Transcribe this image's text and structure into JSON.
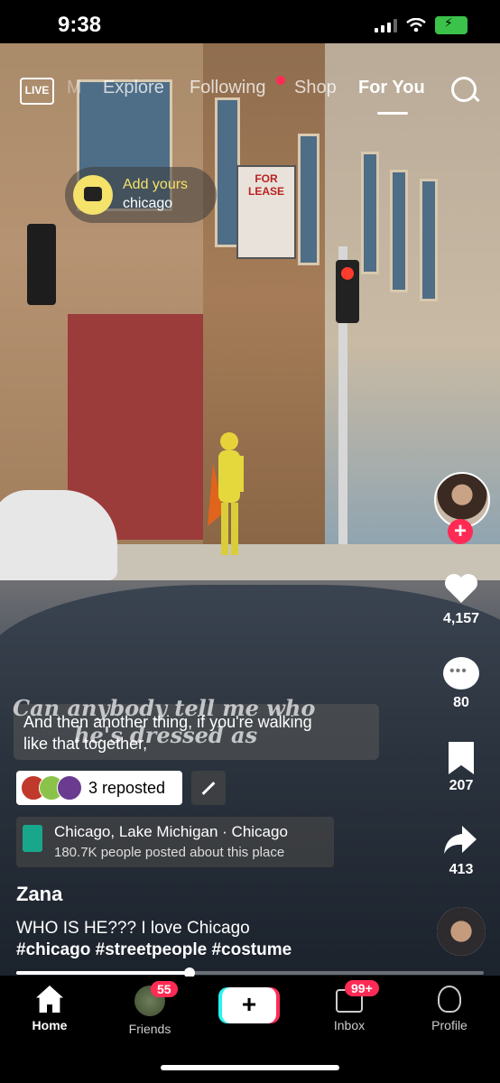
{
  "status_bar": {
    "time": "9:38"
  },
  "top_nav": {
    "live_label": "LIVE",
    "partial_item": "M",
    "items": [
      "Explore",
      "Following",
      "Shop",
      "For You"
    ],
    "active": "For You"
  },
  "add_yours": {
    "label": "Add yours",
    "topic": "chicago"
  },
  "video_overlay_text": {
    "line1": "Can anybody tell me who",
    "line2": "he's dressed as"
  },
  "captions": {
    "line1": "And then another thing, if you're walking",
    "line2": "like that together,"
  },
  "sign_text": "FOR LEASE",
  "rail": {
    "likes": "4,157",
    "comments": "80",
    "saves": "207",
    "shares": "413"
  },
  "repost": {
    "label": "3 reposted"
  },
  "location": {
    "name": "Chicago, Lake Michigan · Chicago",
    "sub": "180.7K people posted about this place"
  },
  "post": {
    "username": "Zana",
    "description": "WHO IS HE??? I love Chicago",
    "hashtags": "#chicago #streetpeople #costume"
  },
  "progress": {
    "fraction": 0.37
  },
  "tab_bar": {
    "home": "Home",
    "friends": "Friends",
    "friends_badge": "55",
    "inbox": "Inbox",
    "inbox_badge": "99+",
    "profile": "Profile",
    "create_symbol": "+"
  },
  "colors": {
    "accent": "#ff2b55",
    "add_yours": "#f4e26b",
    "battery": "#3ac24a",
    "location_pin": "#19a78b"
  }
}
